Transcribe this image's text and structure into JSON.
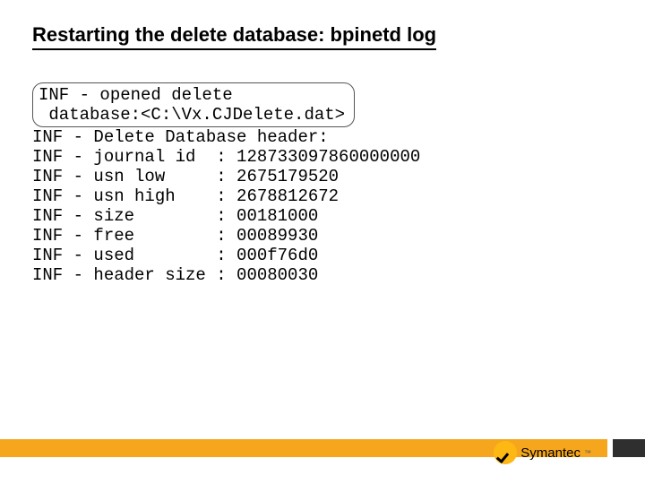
{
  "title": "Restarting the delete database: bpinetd log",
  "highlight": "INF - opened delete\n database:<C:\\Vx.CJDelete.dat>",
  "log_lines": [
    "INF - Delete Database header:",
    "INF - journal id  : 128733097860000000",
    "INF - usn low     : 2675179520",
    "INF - usn high    : 2678812672",
    "INF - size        : 00181000",
    "INF - free        : 00089930",
    "INF - used        : 000f76d0",
    "INF - header size : 00080030"
  ],
  "brand": "Symantec"
}
